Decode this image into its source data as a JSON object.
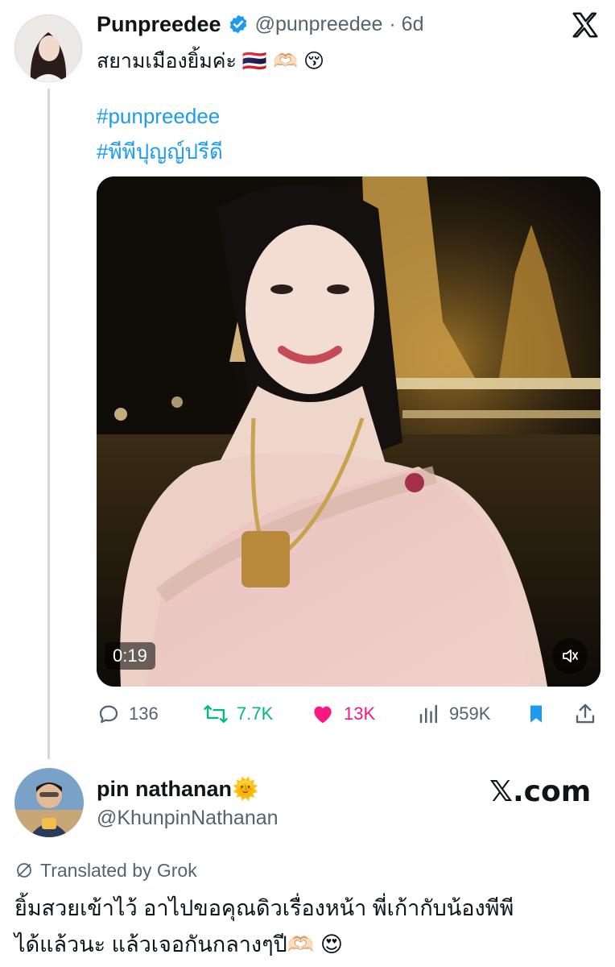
{
  "tweet": {
    "author_name": "Punpreedee",
    "handle": "@punpreedee",
    "time": "· 6d",
    "text": "สยามเมืองยิ้มค่ะ 🇹🇭 🫶🏻 😚",
    "hashtags": [
      "#punpreedee",
      "#พีพีปุญญ์ปรีดี"
    ],
    "video": {
      "duration": "0:19"
    },
    "stats": {
      "replies": "136",
      "reposts": "7.7K",
      "likes": "13K",
      "views": "959K"
    }
  },
  "reply": {
    "author_name": "pin nathanan🌞",
    "handle": "@KhunpinNathanan",
    "brand": "𝕏.com",
    "translated_label": "Translated by Grok",
    "text_line1": "ยิ้มสวยเข้าไว้ อาไปขอคุณดิวเรื่องหน้า พี่เก้ากับน้องพีพี",
    "text_line2": "ได้แล้วนะ แล้วเจอกันกลางๆปี🫶🏻 😍"
  },
  "colors": {
    "accent": "#1d9bf0",
    "repost": "#00ba7c",
    "like": "#f91880",
    "muted": "#536471"
  },
  "icons": [
    "x-logo-icon",
    "verified-badge-icon",
    "reply-icon",
    "repost-icon",
    "heart-icon",
    "views-icon",
    "bookmark-icon",
    "share-icon",
    "volume-icon",
    "grok-icon"
  ]
}
